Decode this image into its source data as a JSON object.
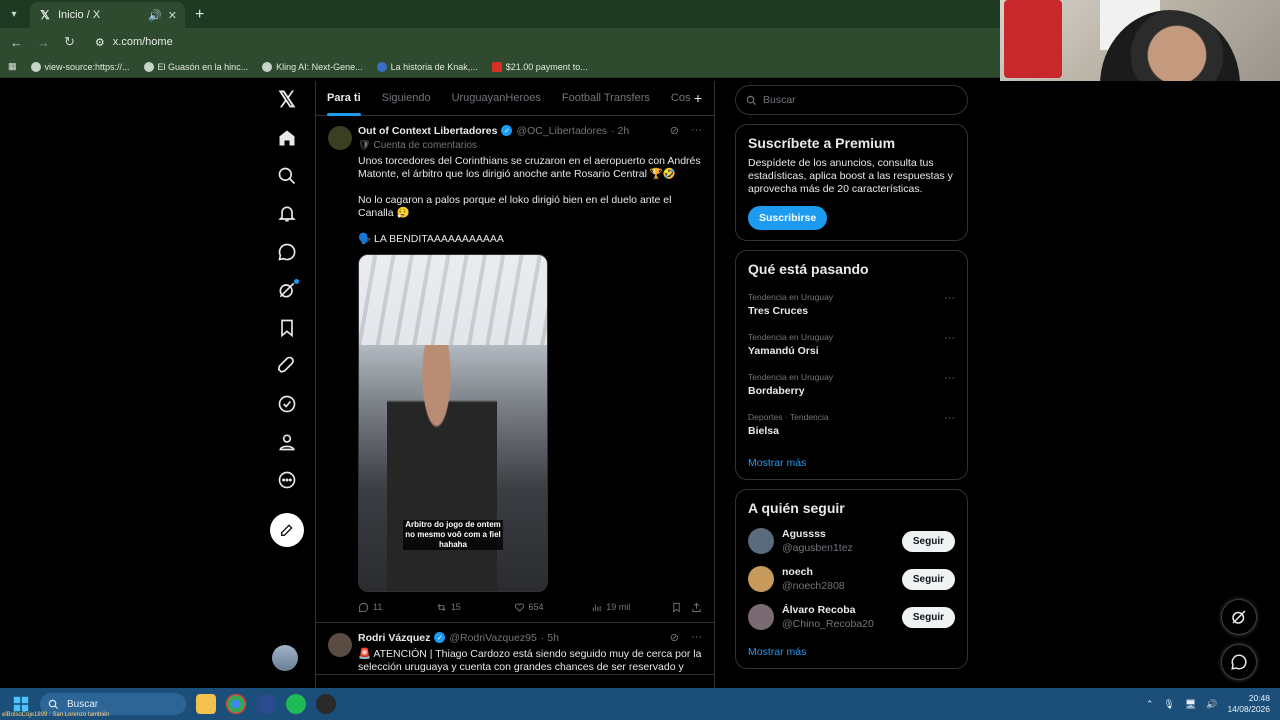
{
  "browser": {
    "tab_title": "Inicio / X",
    "url": "x.com/home",
    "bookmarks": [
      "view-source:https://...",
      "El Guasón en la hinc...",
      "Kling AI: Next-Gene...",
      "La historia de Knak,...",
      "$21.00 payment to..."
    ]
  },
  "timeline": {
    "tabs": [
      "Para ti",
      "Siguiendo",
      "UruguayanHeroes",
      "Football Transfers",
      "Cos"
    ],
    "tweets": [
      {
        "name": "Out of Context Libertadores",
        "handle": "@OC_Libertadores",
        "time": "· 2h",
        "community": "Cuenta de comentarios",
        "text": "Unos torcedores del Corinthians se cruzaron en el aeropuerto con Andrés Matonte, el árbitro que los dirigió anoche ante Rosario Central 🏆🤣\n\nNo lo cagaron a palos porque el loko dirigió bien en el duelo ante el Canalla 😮‍💨\n\n🗣️ LA BENDITAAAAAAAAAAA",
        "media_caption": "Arbitro do jogo de ontem\nno mesmo voô com a fiel\nhahaha",
        "replies": "11",
        "reposts": "15",
        "likes": "654",
        "views": "19 mil"
      },
      {
        "name": "Rodri Vázquez",
        "handle": "@RodriVazquez95",
        "time": "· 5h",
        "text": "🚨 ATENCIÓN | Thiago Cardozo está siendo seguido muy de cerca por la selección uruguaya y cuenta con grandes chances de ser reservado y"
      }
    ]
  },
  "sidebar": {
    "search_placeholder": "Buscar",
    "premium": {
      "title": "Suscríbete a Premium",
      "body": "Despídete de los anuncios, consulta tus estadísticas, aplica boost a las respuestas y aprovecha más de 20 características.",
      "button": "Suscribirse"
    },
    "trending": {
      "title": "Qué está pasando",
      "items": [
        {
          "meta": "Tendencia en Uruguay",
          "topic": "Tres Cruces"
        },
        {
          "meta": "Tendencia en Uruguay",
          "topic": "Yamandú Orsi"
        },
        {
          "meta": "Tendencia en Uruguay",
          "topic": "Bordaberry"
        },
        {
          "meta": "Deportes · Tendencia",
          "topic": "Bielsa"
        }
      ],
      "show_more": "Mostrar más"
    },
    "who_to_follow": {
      "title": "A quién seguir",
      "items": [
        {
          "name": "Agussss",
          "handle": "@agusben1tez",
          "button": "Seguir"
        },
        {
          "name": "noech",
          "handle": "@noech2808",
          "button": "Seguir"
        },
        {
          "name": "Álvaro Recoba",
          "handle": "@Chino_Recoba20",
          "button": "Seguir"
        }
      ],
      "show_more": "Mostrar más"
    }
  },
  "taskbar": {
    "search_label": "Buscar",
    "time": "20:48",
    "date": "14/08/2026",
    "ticker": "elBolsoCoje1899 : San Lorenzo también"
  },
  "colors": {
    "accent": "#1d9bf0",
    "background": "#000000",
    "browser_chrome": "#2e4b30",
    "taskbar": "#1b4f7a"
  }
}
